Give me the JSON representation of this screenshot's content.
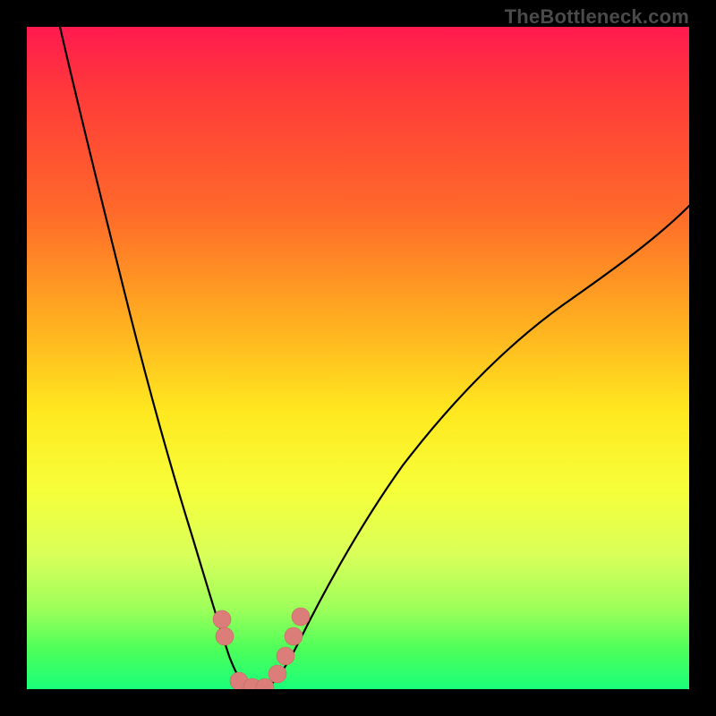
{
  "watermark": "TheBottleneck.com",
  "colors": {
    "gradient_top": "#ff1a4f",
    "gradient_mid1": "#ff6a2a",
    "gradient_mid2": "#ffe81f",
    "gradient_bottom": "#1aff7a",
    "curve_stroke": "#000000",
    "marker_fill": "#db7d78",
    "marker_stroke": "#c76761",
    "frame": "#000000"
  },
  "chart_data": {
    "type": "line",
    "title": "",
    "xlabel": "",
    "ylabel": "",
    "xlim": [
      0,
      100
    ],
    "ylim": [
      0,
      100
    ],
    "grid": false,
    "legend": false,
    "note": "Axes are unlabeled. Values are estimated from pixel positions on a 0–100 normalized scale (100 = top / right of plot area).",
    "series": [
      {
        "name": "left-curve",
        "x": [
          5,
          8,
          11,
          14,
          17,
          20,
          23,
          25,
          27,
          29,
          30.5,
          32,
          34
        ],
        "y": [
          100,
          87,
          75,
          63,
          51,
          40,
          30,
          22,
          15,
          9,
          5,
          2,
          0
        ]
      },
      {
        "name": "right-curve",
        "x": [
          36,
          38,
          40,
          43,
          47,
          52,
          58,
          65,
          73,
          82,
          91,
          100
        ],
        "y": [
          0,
          2,
          6,
          12,
          20,
          29,
          38,
          47,
          55,
          62,
          68,
          73
        ]
      },
      {
        "name": "markers",
        "type": "scatter",
        "x": [
          29.5,
          29.8,
          32.0,
          34.0,
          36.0,
          37.8,
          39.0,
          40.2,
          41.3
        ],
        "y": [
          10.5,
          8.0,
          1.2,
          0.3,
          0.3,
          2.3,
          5.0,
          8.0,
          11.0
        ]
      }
    ]
  }
}
